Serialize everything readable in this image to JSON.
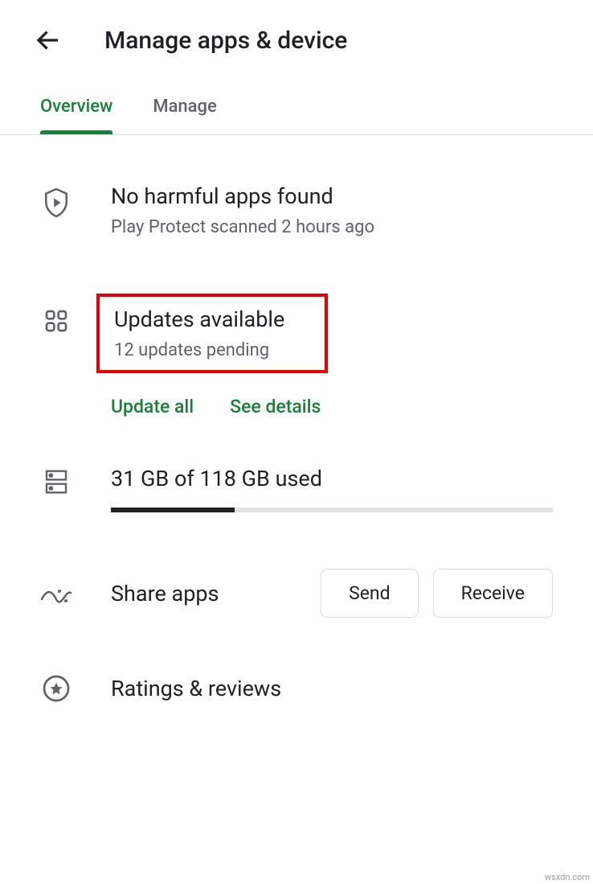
{
  "header": {
    "title": "Manage apps & device"
  },
  "tabs": {
    "overview": "Overview",
    "manage": "Manage"
  },
  "protect": {
    "title": "No harmful apps found",
    "subtitle": "Play Protect scanned 2 hours ago"
  },
  "updates": {
    "title": "Updates available",
    "subtitle": "12 updates pending",
    "update_all": "Update all",
    "see_details": "See details"
  },
  "storage": {
    "label": "31 GB of 118 GB used"
  },
  "share": {
    "label": "Share apps",
    "send": "Send",
    "receive": "Receive"
  },
  "ratings": {
    "label": "Ratings & reviews"
  },
  "watermark": "wsxdn.com"
}
